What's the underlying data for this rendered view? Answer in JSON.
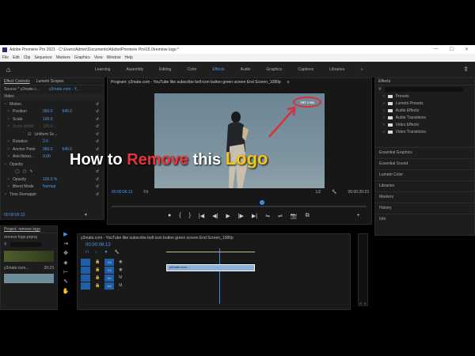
{
  "window": {
    "title": "Adobe Premiere Pro 2021 - C:\\Users\\Admin\\Documents\\Adobe\\Premiere Pro\\15.0\\remove logo *",
    "controls": [
      "—",
      "☐",
      "✕"
    ]
  },
  "menu": [
    "File",
    "Edit",
    "Clip",
    "Sequence",
    "Markers",
    "Graphics",
    "View",
    "Window",
    "Help"
  ],
  "workspaces": [
    {
      "label": "Learning"
    },
    {
      "label": "Assembly"
    },
    {
      "label": "Editing"
    },
    {
      "label": "Color"
    },
    {
      "label": "Effects",
      "active": true
    },
    {
      "label": "Audio"
    },
    {
      "label": "Graphics"
    },
    {
      "label": "Captions"
    },
    {
      "label": "Libraries"
    }
  ],
  "effect_controls": {
    "tabs": [
      "Effect Controls",
      "Lumetri Scopes"
    ],
    "source": "Source * y2mate.c...",
    "clip": "y2mate.com - Y...",
    "section": "Video",
    "rows": [
      {
        "name": "Motion",
        "indent": 1
      },
      {
        "name": "Position",
        "v1": "960.0",
        "v2": "540.0"
      },
      {
        "name": "Scale",
        "v1": "100.0"
      },
      {
        "name": "Scale Width",
        "v1": "100.0",
        "dim": true
      },
      {
        "name": "Uniform Sc...",
        "check": true
      },
      {
        "name": "Rotation",
        "v1": "0.0"
      },
      {
        "name": "Anchor Point",
        "v1": "960.0",
        "v2": "540.0"
      },
      {
        "name": "Anti-flicker...",
        "v1": "0.00"
      },
      {
        "name": "Opacity",
        "indent": 1
      },
      {
        "name": "shapes"
      },
      {
        "name": "Opacity",
        "v1": "100.0 %"
      },
      {
        "name": "Blend Mode",
        "v1": "Normal"
      },
      {
        "name": "Time Remapping",
        "indent": 1
      }
    ],
    "timecode": "00:00:06:13"
  },
  "program": {
    "title": "Program: y2mate.com - YouTube like subscribe bell icon button green screen End Screen_1080p",
    "timecode": "00:00:06:13",
    "fit": "Fit",
    "resolution": "1/2",
    "duration": "00:00:20:23",
    "logo_text": "TRT 1 HD"
  },
  "overlay": {
    "w1": "How to",
    "w2": "Remove",
    "w3": "this",
    "w4": "Logo",
    "colors": {
      "white": "#ffffff",
      "red": "#e8343a",
      "yellow": "#f5c518"
    }
  },
  "transport": [
    "●",
    "{",
    "}",
    "|◀",
    "◀|",
    "▶",
    "|▶",
    "▶|",
    "⇋",
    "⇌",
    "📷",
    "⧉",
    "+"
  ],
  "effects": {
    "title": "Effects",
    "folders": [
      "Presets",
      "Lumetri Presets",
      "Audio Effects",
      "Audio Transitions",
      "Video Effects",
      "Video Transitions"
    ],
    "sections": [
      "Essential Graphics",
      "Essential Sound",
      "Lumetri Color",
      "Libraries",
      "Markers",
      "History",
      "Info"
    ]
  },
  "project": {
    "tab": "Project: remove logo",
    "file": "remove logo.prproj",
    "item_name": "y2mate.com...",
    "item_dur": "20:23"
  },
  "timeline": {
    "title": "y2mate.com - YouTube like subscribe bell icon button green screen End Screen_1080p",
    "timecode": "00:00:06:13",
    "tracks": [
      "V2",
      "V1",
      "A1",
      "A2"
    ],
    "clip": "y2mate.com..."
  },
  "meter": {
    "labels": [
      "S",
      "S"
    ]
  },
  "accent": "#4a9cf0"
}
